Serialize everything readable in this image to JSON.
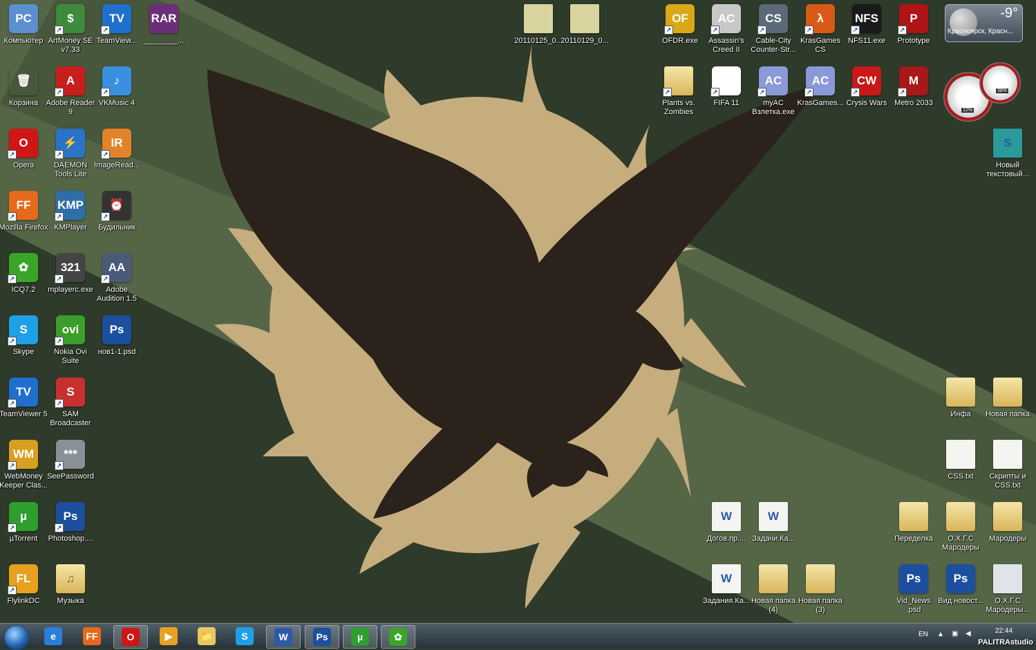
{
  "desktop": {
    "icons": [
      {
        "label": "Компьютер",
        "symbol": "PC",
        "color": "#5b8fd0"
      },
      {
        "label": "ArtMoney SE v7.33",
        "symbol": "$",
        "color": "#3e8a3e"
      },
      {
        "label": "TeamView...",
        "symbol": "TV",
        "color": "#1f6fcc"
      },
      {
        "label": "________...",
        "symbol": "RAR",
        "color": "#6b2f7a"
      },
      {
        "label": "Корзина",
        "symbol": "🗑",
        "color": "#7a9aa0"
      },
      {
        "label": "Adobe Reader 9",
        "symbol": "A",
        "color": "#c81e1e"
      },
      {
        "label": "VKMusic 4",
        "symbol": "♪",
        "color": "#3b8fe0"
      },
      {
        "label": "Opera",
        "symbol": "O",
        "color": "#d01515"
      },
      {
        "label": "DAEMON Tools Lite",
        "symbol": "⚡",
        "color": "#2a74c8"
      },
      {
        "label": "ImageRead...",
        "symbol": "IR",
        "color": "#e0832a"
      },
      {
        "label": "Mozilla Firefox",
        "symbol": "FF",
        "color": "#e66a1c"
      },
      {
        "label": "KMPlayer",
        "symbol": "KMP",
        "color": "#2e6fa8"
      },
      {
        "label": "Будильник",
        "symbol": "⏰",
        "color": "#333333"
      },
      {
        "label": "ICQ7.2",
        "symbol": "✿",
        "color": "#39a62a"
      },
      {
        "label": "mplayerc.exe",
        "symbol": "321",
        "color": "#444444"
      },
      {
        "label": "Adobe Audition 1.5",
        "symbol": "AA",
        "color": "#4a5a78"
      },
      {
        "label": "Skype",
        "symbol": "S",
        "color": "#1ea0e6"
      },
      {
        "label": "Nokia Ovi Suite",
        "symbol": "ovi",
        "color": "#3c9e2a"
      },
      {
        "label": "нов1-1.psd",
        "symbol": "Ps",
        "color": "#1c4f9e"
      },
      {
        "label": "TeamViewer 5",
        "symbol": "TV",
        "color": "#1f6fcc"
      },
      {
        "label": "SAM Broadcaster",
        "symbol": "S",
        "color": "#c83030"
      },
      {
        "label": "WebMoney Keeper Clas...",
        "symbol": "WM",
        "color": "#d8a020"
      },
      {
        "label": "SeePassword",
        "symbol": "***",
        "color": "#8a9098"
      },
      {
        "label": "µTorrent",
        "symbol": "µ",
        "color": "#2e9e2e"
      },
      {
        "label": "Photoshop....",
        "symbol": "Ps",
        "color": "#1c4f9e"
      },
      {
        "label": "FlylinkDC",
        "symbol": "FL",
        "color": "#e8a020"
      },
      {
        "label": "Музыка",
        "symbol": "♫",
        "color": "#c9a956"
      },
      {
        "label": "20110125_0...",
        "symbol": "",
        "color": "#d8d4a0"
      },
      {
        "label": "20110129_0...",
        "symbol": "",
        "color": "#d8d4a0"
      },
      {
        "label": "OFDR.exe",
        "symbol": "OF",
        "color": "#d8a818"
      },
      {
        "label": "Assassin's Creed II",
        "symbol": "AC",
        "color": "#c8c8c8"
      },
      {
        "label": "Cable-City Counter-Str...",
        "symbol": "CS",
        "color": "#5a6a78"
      },
      {
        "label": "KrasGames CS",
        "symbol": "λ",
        "color": "#d85a18"
      },
      {
        "label": "NFS11.exe",
        "symbol": "NFS",
        "color": "#1a1a1a"
      },
      {
        "label": "Prototype",
        "symbol": "P",
        "color": "#b01414"
      },
      {
        "label": "Plants vs. Zombies",
        "symbol": "",
        "color": "#d8c890"
      },
      {
        "label": "FIFA 11",
        "symbol": "EA",
        "color": "#ffffff"
      },
      {
        "label": "myAC Взлетка.exe",
        "symbol": "AC",
        "color": "#8a9ad8"
      },
      {
        "label": "KrasGames...",
        "symbol": "AC",
        "color": "#8a9ad8"
      },
      {
        "label": "Crysis Wars",
        "symbol": "CW",
        "color": "#c81818"
      },
      {
        "label": "Metro 2033",
        "symbol": "M",
        "color": "#a81818"
      },
      {
        "label": "Новый текстовый...",
        "symbol": "S",
        "color": "#2a9a9a"
      },
      {
        "label": "Инфа",
        "symbol": "",
        "color": "#e8d890"
      },
      {
        "label": "Новая папка",
        "symbol": "",
        "color": "#e8d890"
      },
      {
        "label": "CSS.txt",
        "symbol": "",
        "color": "#f4f4f4"
      },
      {
        "label": "Скрипты и CSS.txt",
        "symbol": "",
        "color": "#f4f4f4"
      },
      {
        "label": "Догов.пр....",
        "symbol": "W",
        "color": "#f4f4f4"
      },
      {
        "label": "Задачи.Ка...",
        "symbol": "W",
        "color": "#f4f4f4"
      },
      {
        "label": "Переделка",
        "symbol": "",
        "color": "#e8d890"
      },
      {
        "label": "О.Х.Г.С Мародеры",
        "symbol": "",
        "color": "#e8d890"
      },
      {
        "label": "Мародеры",
        "symbol": "",
        "color": "#e8d890"
      },
      {
        "label": "Задания.Ка...",
        "symbol": "W",
        "color": "#f4f4f4"
      },
      {
        "label": "Новая папка (4)",
        "symbol": "",
        "color": "#e8d890"
      },
      {
        "label": "Новая папка (3)",
        "symbol": "",
        "color": "#e8d890"
      },
      {
        "label": "Vid_News .psd",
        "symbol": "Ps",
        "color": "#1c4f9e"
      },
      {
        "label": "Вид новост...",
        "symbol": "Ps",
        "color": "#1c4f9e"
      },
      {
        "label": "О.Х.Г.С Мародеры...",
        "symbol": "",
        "color": "#e0e4ea"
      }
    ]
  },
  "weather_gadget": {
    "temperature": "-9°",
    "location": "Красноярск, Красн..."
  },
  "cpu_gadget": {
    "cpu": "12%",
    "ram": "38%"
  },
  "taskbar": {
    "pinned": [
      {
        "name": "internet-explorer",
        "symbol": "e",
        "color": "#2a7fd8"
      },
      {
        "name": "firefox",
        "symbol": "FF",
        "color": "#e66a1c"
      },
      {
        "name": "opera",
        "symbol": "O",
        "color": "#d01515"
      },
      {
        "name": "media-player",
        "symbol": "▶",
        "color": "#e8a020"
      },
      {
        "name": "explorer",
        "symbol": "📁",
        "color": "#e8c860"
      },
      {
        "name": "skype",
        "symbol": "S",
        "color": "#1ea0e6"
      },
      {
        "name": "word",
        "symbol": "W",
        "color": "#2b5aa8"
      },
      {
        "name": "photoshop",
        "symbol": "Ps",
        "color": "#1c4f9e"
      },
      {
        "name": "utorrent",
        "symbol": "µ",
        "color": "#2e9e2e"
      },
      {
        "name": "icq",
        "symbol": "✿",
        "color": "#39a62a"
      }
    ],
    "language": "EN",
    "clock": "22:44"
  },
  "watermark": "PALITRAstudio"
}
